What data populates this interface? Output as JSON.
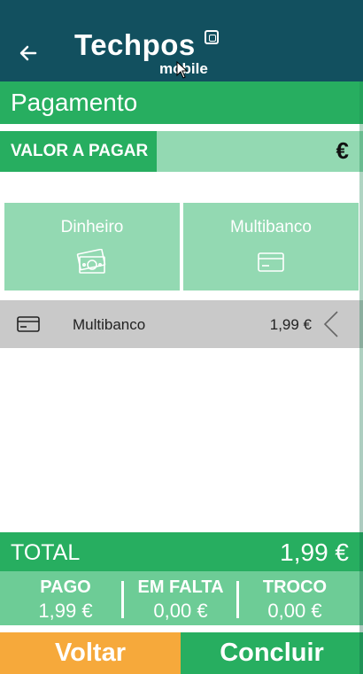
{
  "header": {
    "back_icon": "arrow-left-icon",
    "logo_name": "Techpos",
    "logo_sub": "mobile"
  },
  "page": {
    "title": "Pagamento"
  },
  "amount": {
    "label": "VALOR A PAGAR",
    "currency": "€"
  },
  "methods": [
    {
      "label": "Dinheiro",
      "icon": "cash-icon"
    },
    {
      "label": "Multibanco",
      "icon": "card-icon"
    }
  ],
  "payments": [
    {
      "icon": "card-icon",
      "name": "Multibanco",
      "amount": "1,99 €",
      "action_icon": "chevron-left-icon"
    }
  ],
  "totals": {
    "total_label": "TOTAL",
    "total_value": "1,99 €",
    "paid_label": "PAGO",
    "paid_value": "1,99 €",
    "missing_label": "EM FALTA",
    "missing_value": "0,00 €",
    "change_label": "TROCO",
    "change_value": "0,00 €"
  },
  "actions": {
    "back_label": "Voltar",
    "done_label": "Concluir"
  },
  "colors": {
    "header": "#12505f",
    "primary": "#27ae60",
    "light": "#93d9b2",
    "summary": "#6dcc96",
    "back_button": "#f6a93b",
    "row": "#c9c9c9"
  }
}
